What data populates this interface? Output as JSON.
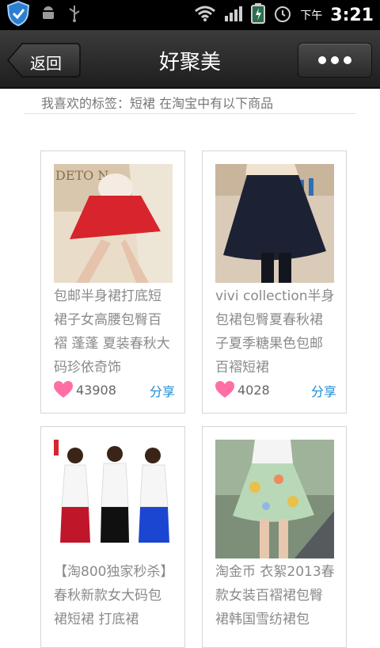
{
  "status_bar": {
    "ampm": "下午",
    "time": "3:21"
  },
  "header": {
    "back_label": "返回",
    "title": "好聚美"
  },
  "subheader": {
    "text": "我喜欢的标签：短裙 在淘宝中有以下商品"
  },
  "products": [
    {
      "title": "包邮半身裙打底短裙子女高腰包臀百褶 蓬蓬 夏装春秋大码珍依奇饰",
      "likes": "43908",
      "share": "分享",
      "image_text": "DETO N"
    },
    {
      "title": "vivi collection半身包裙包臀夏春秋裙子夏季糖果色包邮百褶短裙",
      "likes": "4028",
      "share": "分享"
    },
    {
      "title": "【淘800独家秒杀】春秋新款女大码包裙短裙 打底裙"
    },
    {
      "title": "淘金币 衣絮2013春款女装百褶裙包臀裙韩国雪纺裙包"
    }
  ],
  "colors": {
    "share": "#1a8bd6",
    "heart": "#ff6fa3"
  }
}
